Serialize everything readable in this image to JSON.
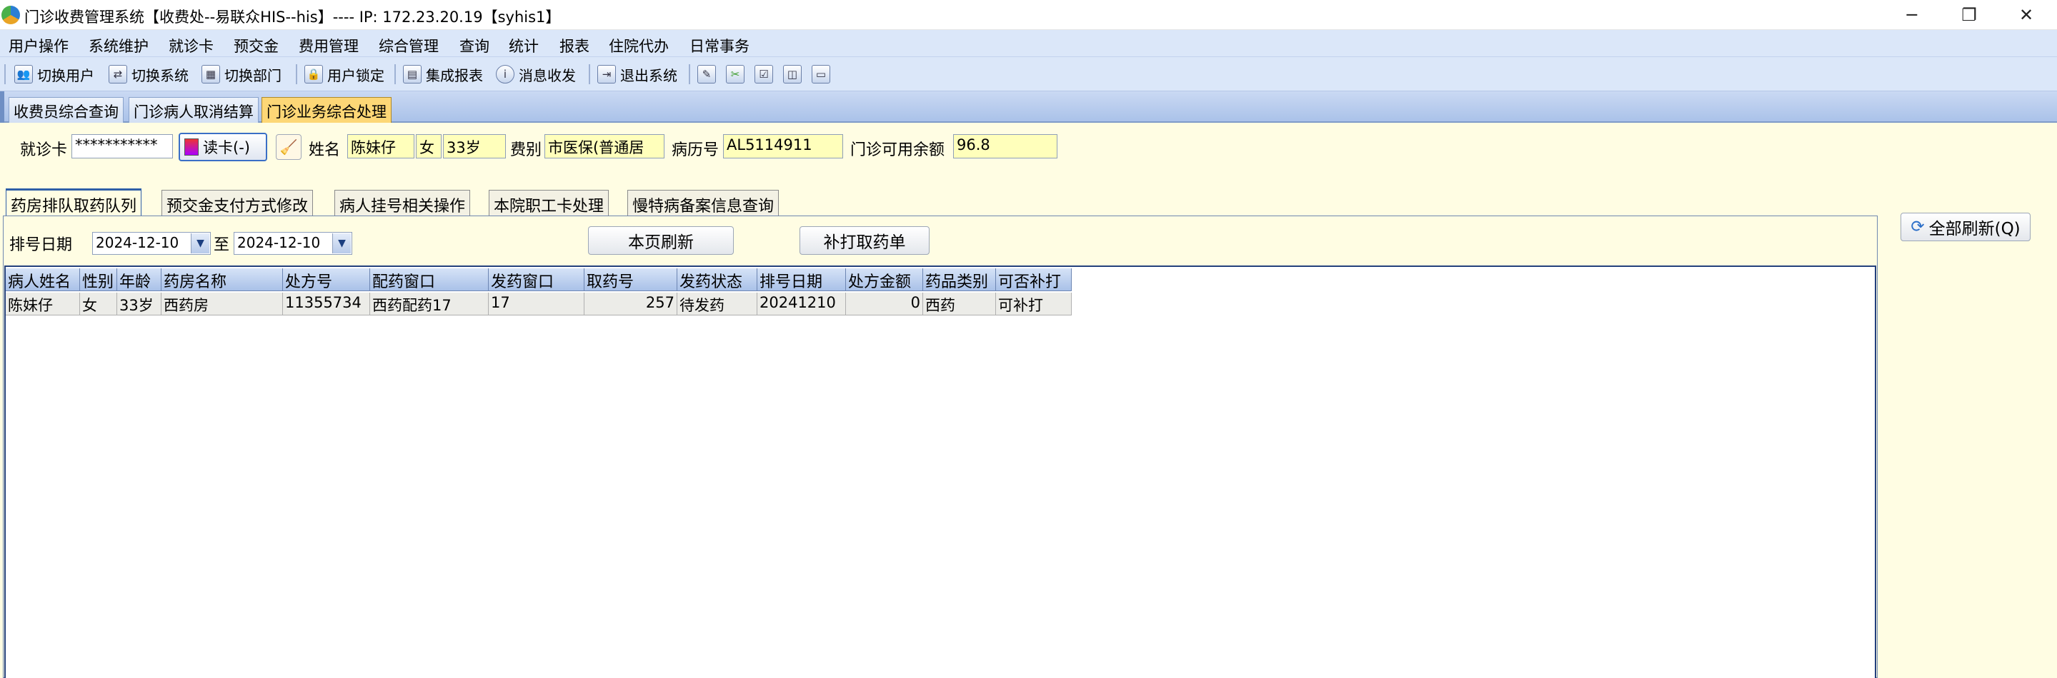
{
  "window": {
    "title": "门诊收费管理系统【收费处--易联众HIS--his】---- IP:  172.23.20.19【syhis1】",
    "minimize": "─",
    "restore": "❐",
    "close": "✕"
  },
  "menu": [
    "用户操作",
    "系统维护",
    "就诊卡",
    "预交金",
    "费用管理",
    "综合管理",
    "查询",
    "统计",
    "报表",
    "住院代办",
    "日常事务"
  ],
  "toolbar": {
    "switch_user": "切换用户",
    "switch_system": "切换系统",
    "switch_dept": "切换部门",
    "lock_user": "用户锁定",
    "integrated_report": "集成报表",
    "messages": "消息收发",
    "exit": "退出系统"
  },
  "top_tabs": [
    "收费员综合查询",
    "门诊病人取消结算",
    "门诊业务综合处理"
  ],
  "patient": {
    "card_label": "就诊卡",
    "card_value": "***********",
    "read_card": "读卡(-)",
    "name_label": "姓名",
    "name": "陈妹仔",
    "sex": "女",
    "age": "33岁",
    "fee_label": "费别",
    "fee_type": "市医保(普通居",
    "record_label": "病历号",
    "record_no": "AL5114911",
    "balance_label": "门诊可用余额",
    "balance": "96.8"
  },
  "sub_tabs": [
    "药房排队取药队列",
    "预交金支付方式修改",
    "病人挂号相关操作",
    "本院职工卡处理",
    "慢特病备案信息查询"
  ],
  "queue": {
    "date_label": "排号日期",
    "date_from": "2024-12-10",
    "to_label": "至",
    "date_to": "2024-12-10",
    "refresh_page": "本页刷新",
    "reprint": "补打取药单",
    "refresh_all": "全部刷新(Q)"
  },
  "table": {
    "columns": [
      "病人姓名",
      "性别",
      "年龄",
      "药房名称",
      "处方号",
      "配药窗口",
      "发药窗口",
      "取药号",
      "发药状态",
      "排号日期",
      "处方金额",
      "药品类别",
      "可否补打"
    ],
    "rows": [
      [
        "陈妹仔",
        "女",
        "33岁",
        "西药房",
        "11355734",
        "西药配药17",
        "17",
        "257",
        "待发药",
        "20241210",
        "0",
        "西药",
        "可补打"
      ]
    ]
  }
}
